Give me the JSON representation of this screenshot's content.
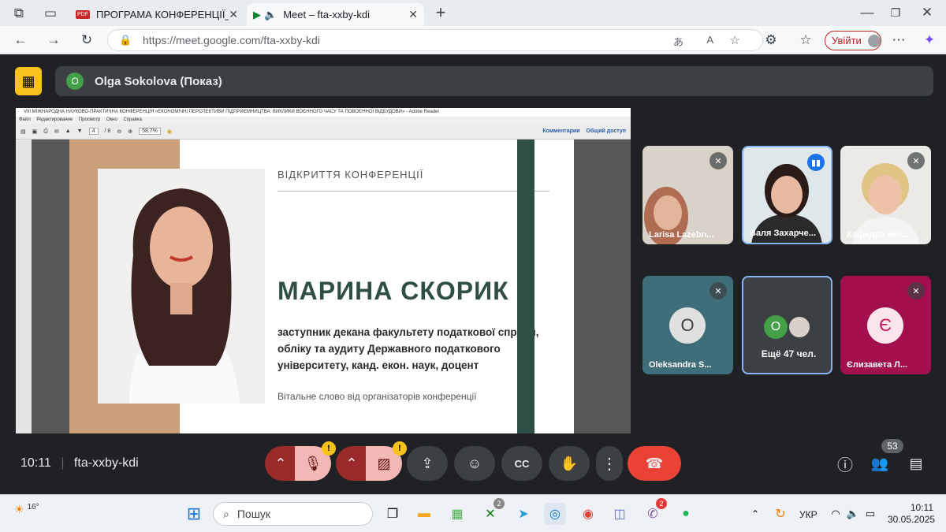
{
  "tabs": [
    {
      "label": "ПРОГРАМА КОНФЕРЕНЦІЇ_Плен..."
    },
    {
      "label": "Meet – fta-xxby-kdi"
    }
  ],
  "address": {
    "url": "https://meet.google.com/fta-xxby-kdi",
    "signin": "Увійти"
  },
  "presenting": {
    "avatar": "O",
    "label": "Olga Sokolova (Показ)"
  },
  "reader": {
    "title": "VIII МІЖНАРОДНА НАУКОВО-ПРАКТИЧНА КОНФЕРЕНЦІЯ «ЕКОНОМІЧНІ ПЕРСПЕКТИВИ ПІДПРИЄМНИЦТВА: ВИКЛИКИ ВОЄННОГО ЧАСУ ТА ПОВОЄННОЇ ВІДБУДОВИ» - Adobe Reader",
    "menu": "Файл Редактирование Просмотр Окно Справка",
    "page": "4",
    "pages": "/ 8",
    "zoom": "58,7%",
    "comments": "Комментарии",
    "share": "Общий доступ"
  },
  "slide": {
    "header": "ВІДКРИТТЯ КОНФЕРЕНЦІЇ",
    "name": "МАРИНА СКОРИК",
    "position": "заступник декана факультету податкової справи, обліку та аудиту Державного податкового університету, канд. екон. наук, доцент",
    "greeting": "Вітальне слово від організаторів конференції"
  },
  "participants": [
    {
      "name": "Larisa Lazebn...",
      "muted": true
    },
    {
      "name": "Валя Захарче...",
      "speaking": true
    },
    {
      "name": "Кафедра еко...",
      "muted": true
    },
    {
      "name": "Oleksandra S...",
      "avatar": "O",
      "muted": true
    },
    {
      "name": "Ещё 47 чел.",
      "avatar": "O"
    },
    {
      "name": "Єлизавета Л...",
      "avatar": "Є",
      "muted": true
    }
  ],
  "meeting": {
    "time": "10:11",
    "code": "fta-xxby-kdi",
    "participant_count": "53"
  },
  "taskbar": {
    "weather": "16°",
    "search": "Пошук",
    "lang": "УКР",
    "time": "10:11",
    "date": "30.05.2025",
    "badge_xbox": "2",
    "badge_viber": "2"
  },
  "colors": {
    "accent": "#8ab4f8",
    "end_call": "#ea4335",
    "warning": "#f9c21b",
    "slide_green": "#2f4f46"
  }
}
